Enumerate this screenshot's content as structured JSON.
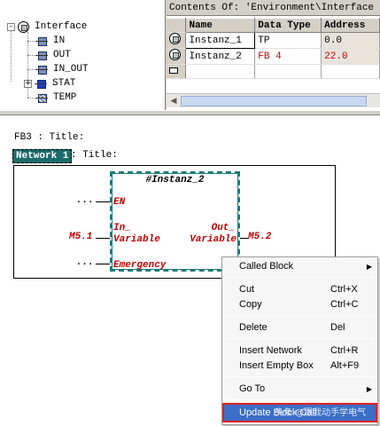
{
  "tree": {
    "items": [
      {
        "label": "Interface",
        "icon": "interface-icon",
        "expander": "-"
      },
      {
        "label": "IN",
        "icon": "pin-icon"
      },
      {
        "label": "OUT",
        "icon": "pin-icon"
      },
      {
        "label": "IN_OUT",
        "icon": "pin-icon"
      },
      {
        "label": "STAT",
        "icon": "stat-icon",
        "expander": "+"
      },
      {
        "label": "TEMP",
        "icon": "temp-icon"
      }
    ]
  },
  "contents": {
    "title": "Contents Of: 'Environment\\Interface",
    "columns": [
      "Name",
      "Data Type",
      "Address"
    ],
    "rows": [
      {
        "name": "Instanz_1",
        "type": "TP",
        "address": "0.0"
      },
      {
        "name": "Instanz_2",
        "type": "FB 4",
        "address": "22.0"
      }
    ]
  },
  "network": {
    "fb_title": "FB3 : Title:",
    "network_label": "Network 1",
    "network_title": ": Title:",
    "block": {
      "instance": "#Instanz_2",
      "pins_in": [
        "EN",
        "In_",
        "Variable",
        "Emergency"
      ],
      "pins_out": [
        "Out_",
        "Variable"
      ],
      "en_connection": "...",
      "in_connection": "M5.1",
      "emergency_connection": "...",
      "out_connection": "M5.2"
    }
  },
  "context_menu": {
    "items": [
      {
        "label": "Called Block",
        "shortcut": "",
        "submenu": true
      },
      {
        "label": "Cut",
        "shortcut": "Ctrl+X"
      },
      {
        "label": "Copy",
        "shortcut": "Ctrl+C"
      },
      {
        "label": "Delete",
        "shortcut": "Del"
      },
      {
        "label": "Insert Network",
        "shortcut": "Ctrl+R"
      },
      {
        "label": "Insert Empty Box",
        "shortcut": "Alt+F9"
      },
      {
        "label": "Go To",
        "shortcut": "",
        "submenu": true
      },
      {
        "label": "Update Block Call",
        "shortcut": ""
      }
    ]
  },
  "watermark": "头条 @跟我动手学电气",
  "colors": {
    "network_label_bg": "#1d6b6b",
    "highlight": "#3b6ec7",
    "red_text": "#c00000"
  }
}
